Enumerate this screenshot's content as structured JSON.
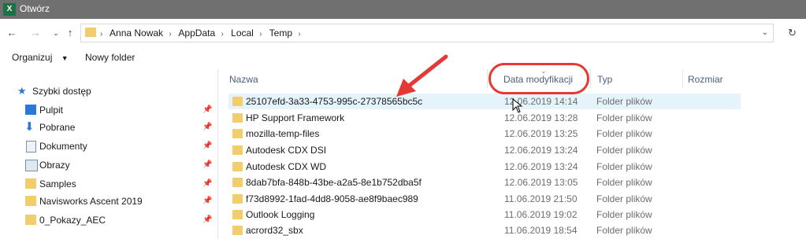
{
  "window": {
    "title": "Otwórz",
    "app_icon": "excel-icon"
  },
  "address": {
    "crumbs": [
      "Anna Nowak",
      "AppData",
      "Local",
      "Temp"
    ]
  },
  "toolbar": {
    "organize_label": "Organizuj",
    "new_folder_label": "Nowy folder"
  },
  "tree": {
    "items": [
      {
        "label": "Szybki dostęp",
        "icon": "star-icon",
        "pinned": false
      },
      {
        "label": "Pulpit",
        "icon": "desktop-icon",
        "pinned": true
      },
      {
        "label": "Pobrane",
        "icon": "download-icon",
        "pinned": true
      },
      {
        "label": "Dokumenty",
        "icon": "document-icon",
        "pinned": true
      },
      {
        "label": "Obrazy",
        "icon": "pictures-icon",
        "pinned": true
      },
      {
        "label": "Samples",
        "icon": "folder-icon",
        "pinned": true
      },
      {
        "label": "Navisworks Ascent 2019",
        "icon": "folder-icon",
        "pinned": true
      },
      {
        "label": "0_Pokazy_AEC",
        "icon": "folder-icon",
        "pinned": true
      }
    ]
  },
  "columns": {
    "name": "Nazwa",
    "date": "Data modyfikacji",
    "type": "Typ",
    "size": "Rozmiar"
  },
  "files": [
    {
      "name": "25107efd-3a33-4753-995c-27378565bc5c",
      "date": "12.06.2019 14:14",
      "type": "Folder plików"
    },
    {
      "name": "HP Support Framework",
      "date": "12.06.2019 13:28",
      "type": "Folder plików"
    },
    {
      "name": "mozilla-temp-files",
      "date": "12.06.2019 13:25",
      "type": "Folder plików"
    },
    {
      "name": "Autodesk CDX DSI",
      "date": "12.06.2019 13:24",
      "type": "Folder plików"
    },
    {
      "name": "Autodesk CDX WD",
      "date": "12.06.2019 13:24",
      "type": "Folder plików"
    },
    {
      "name": "8dab7bfa-848b-43be-a2a5-8e1b752dba5f",
      "date": "12.06.2019 13:05",
      "type": "Folder plików"
    },
    {
      "name": "f73d8992-1fad-4dd8-9058-ae8f9baec989",
      "date": "11.06.2019 21:50",
      "type": "Folder plików"
    },
    {
      "name": "Outlook Logging",
      "date": "11.06.2019 19:02",
      "type": "Folder plików"
    },
    {
      "name": "acrord32_sbx",
      "date": "11.06.2019 18:54",
      "type": "Folder plików"
    }
  ],
  "colors": {
    "annotation": "#e53935",
    "folder": "#f2cd6b",
    "selection": "#e5f3fb",
    "titlebar": "#707070"
  }
}
